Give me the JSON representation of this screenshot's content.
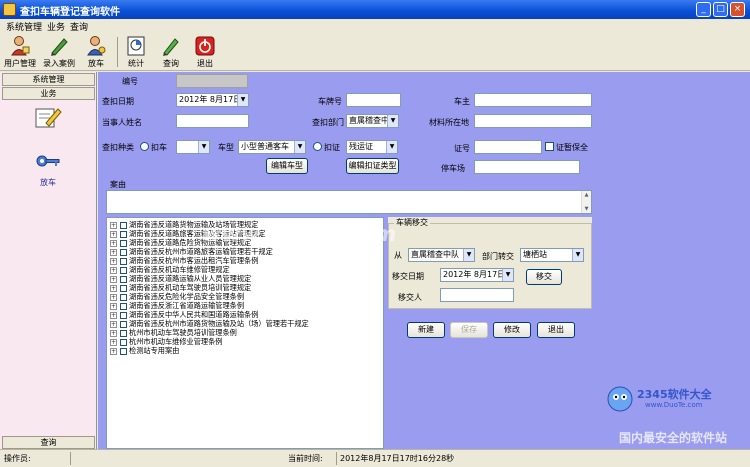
{
  "window": {
    "title": "查扣车辆登记查询软件"
  },
  "menu": [
    "系统管理",
    "业务",
    "查询"
  ],
  "toolbar": [
    {
      "label": "用户管理",
      "icon": "user-manage-icon"
    },
    {
      "label": "录入案例",
      "icon": "pen-icon"
    },
    {
      "label": "放车",
      "icon": "user-release-icon"
    },
    {
      "label": "统计",
      "icon": "stats-icon"
    },
    {
      "label": "查询",
      "icon": "search-pen-icon"
    },
    {
      "label": "退出",
      "icon": "exit-icon"
    }
  ],
  "sidebar": {
    "tab_system": "系统管理",
    "tab_business": "业务",
    "tab_query": "查询",
    "items": [
      {
        "label": "录入案例",
        "icon": "edit-icon"
      },
      {
        "label": "放车",
        "icon": "key-icon"
      }
    ]
  },
  "form": {
    "number_label": "编号",
    "number_value": "",
    "date_label": "查扣日期",
    "date_value": "2012年 8月17日",
    "plate_label": "车牌号",
    "plate_value": "",
    "owner_label": "车主",
    "owner_value": "",
    "party_label": "当事人姓名",
    "party_value": "",
    "dept_label": "查扣部门",
    "dept_value": "直属稽查中",
    "location_label": "材料所在地",
    "location_value": "",
    "type_label": "查扣种类",
    "type_option_car": "扣车",
    "type_car_select": "",
    "vehicle_label": "车型",
    "vehicle_value": "小型普通客车",
    "type_option_cert": "扣证",
    "cert_select": "残运证",
    "cert_no_label": "证号",
    "cert_no_value": "",
    "cert_keep_label": "证暂保全",
    "edit_vehicle_btn": "编辑车型",
    "edit_cert_btn": "编辑扣证类型",
    "parking_label": "停车场",
    "parking_value": "",
    "reason_label": "案由"
  },
  "tree_items": [
    "湖南省违反道路货物运输及站场管理规定",
    "湖南省违反道路旅客运输及客运站管理规定",
    "湖南省违反道路危险货物运输管理规定",
    "湖南省违反杭州市道路旅客运输管理若干规定",
    "湖南省违反杭州市客运出租汽车管理条例",
    "湖南省违反机动车维修管理规定",
    "湖南省违反道路运输从业人员管理规定",
    "湖南省违反机动车驾驶员培训管理规定",
    "湖南省违反危险化学品安全管理条例",
    "湖南省违反浙江省道路运输管理条例",
    "湖南省违反中华人民共和国道路运输条例",
    "湖南省违反杭州市道路货物运输及站（场）管理若干规定",
    "杭州市机动车驾驶员培训管理条例",
    "杭州市机动车维修业管理条例",
    "检测站专用案由"
  ],
  "transfer": {
    "title": "车辆移交",
    "from_label": "从",
    "from_value": "直属稽查中队",
    "dept_label": "部门转交",
    "dept_value": "塘栖站",
    "date_label": "移交日期",
    "date_value": "2012年 8月17日",
    "transfer_btn": "移交",
    "person_label": "移交人",
    "person_value": ""
  },
  "actions": {
    "new": "新建",
    "save": "保存",
    "edit": "修改",
    "exit": "退出"
  },
  "status": {
    "operator_label": "操作员:",
    "operator_value": "",
    "time_label": "当前时间:",
    "time_value": "2012年8月17日17时16分28秒"
  },
  "watermark": {
    "site": "www.DuoTe.com",
    "brand": "2345软件大全",
    "brand_url": "www.DuoTe.com",
    "slogan": "国内最安全的软件站"
  },
  "colors": {
    "form_bg": "#9a9cf0",
    "sidebar_bg": "#f9e8ef",
    "titlebar": "#0a52d8"
  }
}
